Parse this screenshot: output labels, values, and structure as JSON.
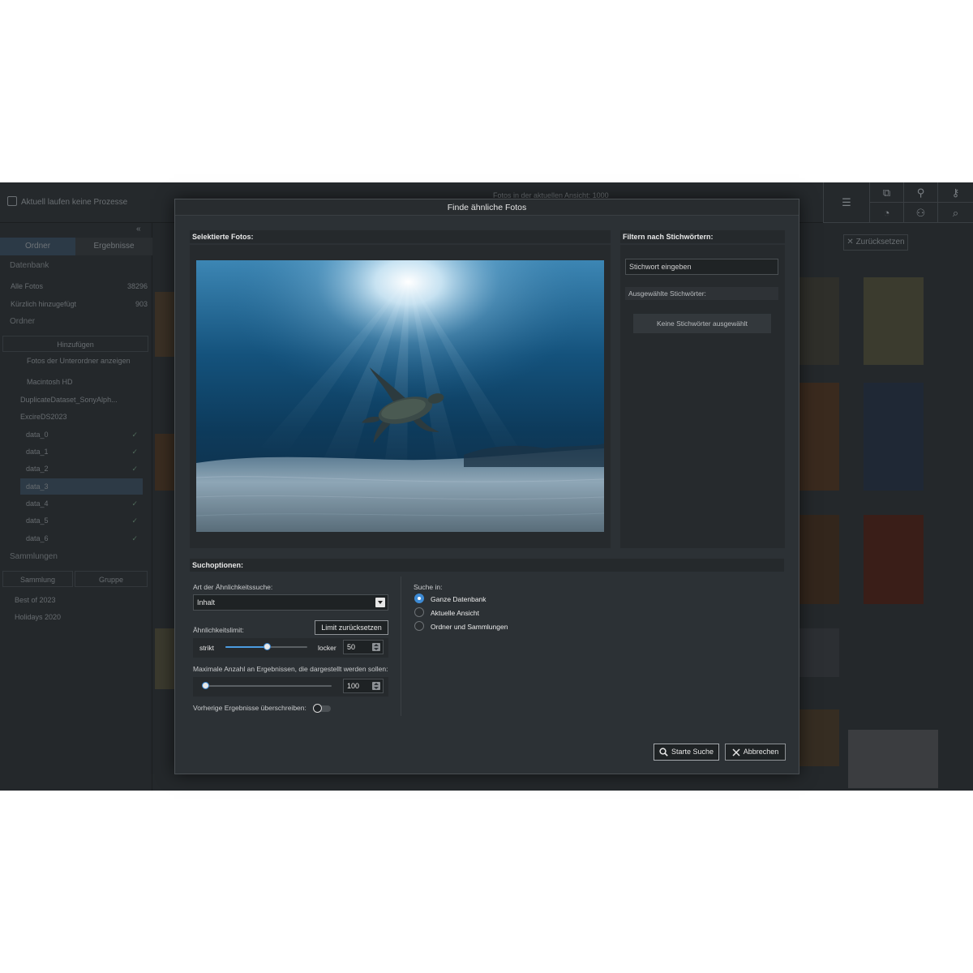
{
  "background_app": {
    "status_text": "Aktuell laufen keine Prozesse",
    "photo_count_text": "Fotos in der aktuellen Ansicht: 1000",
    "reset_filter_label": "Zurücksetzen",
    "sidebar": {
      "tab_folders": "Ordner",
      "tab_results": "Ergebnisse",
      "database_header": "Datenbank",
      "all_photos_label": "Alle Fotos",
      "all_photos_count": "38296",
      "recently_added_label": "Kürzlich hinzugefügt",
      "recently_added_count": "903",
      "folders_header": "Ordner",
      "add_label": "Hinzufügen",
      "show_subfolders_label": "Fotos der Unterordner anzeigen",
      "disk_label": "Macintosh HD",
      "folder_items": [
        "DuplicateDataset_SonyAlph...",
        "ExcireDS2023",
        "data_0",
        "data_1",
        "data_2",
        "data_3",
        "data_4",
        "data_5",
        "data_6"
      ],
      "collections_header": "Sammlungen",
      "add_collection_label": "Sammlung",
      "add_group_label": "Gruppe",
      "collection_items": [
        "Best of 2023",
        "Holidays 2020"
      ]
    }
  },
  "dialog": {
    "title": "Finde ähnliche Fotos",
    "selected_photos_header": "Selektierte Fotos:",
    "keyword_filter_header": "Filtern nach Stichwörtern:",
    "keyword_input_placeholder": "Stichwort eingeben",
    "selected_keywords_header": "Ausgewählte Stichwörter:",
    "no_keywords_text": "Keine Stichwörter ausgewählt",
    "search_options_header": "Suchoptionen:",
    "similarity_type_label": "Art der Ähnlichkeitssuche:",
    "similarity_type_value": "Inhalt",
    "similarity_limit_label": "Ähnlichkeitslimit:",
    "reset_limit_button": "Limit zurücksetzen",
    "strict_label": "strikt",
    "loose_label": "locker",
    "similarity_limit_value": "50",
    "similarity_limit_fraction": 0.5,
    "max_results_label": "Maximale Anzahl an Ergebnissen, die dargestellt werden sollen:",
    "max_results_value": "100",
    "max_results_fraction": 0.0,
    "overwrite_label": "Vorherige Ergebnisse überschreiben:",
    "overwrite_enabled": false,
    "search_in_label": "Suche in:",
    "search_in_options": [
      "Ganze Datenbank",
      "Aktuelle Ansicht",
      "Ordner und Sammlungen"
    ],
    "search_in_selected": "Ganze Datenbank",
    "start_button": "Starte Suche",
    "cancel_button": "Abbrechen",
    "accent_color": "#3d8ad4"
  }
}
